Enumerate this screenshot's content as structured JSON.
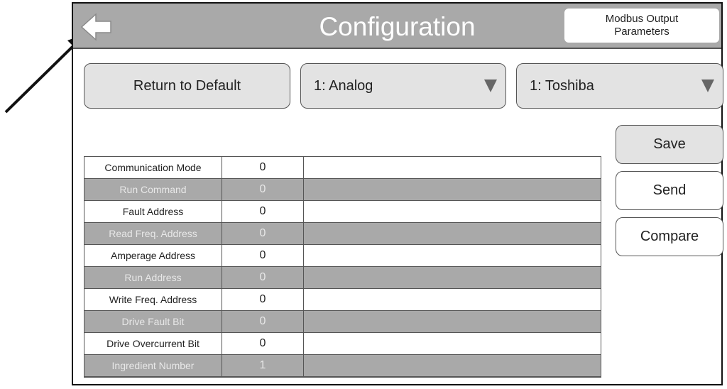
{
  "header": {
    "title": "Configuration",
    "page_label": "Modbus Output Parameters"
  },
  "controls": {
    "return_default_label": "Return to Default",
    "dropdown_mode_value": "1: Analog",
    "dropdown_drive_value": "1: Toshiba"
  },
  "side_buttons": {
    "save_label": "Save",
    "send_label": "Send",
    "compare_label": "Compare"
  },
  "parameters": [
    {
      "name": "Communication Mode",
      "value": "0",
      "note": ""
    },
    {
      "name": "Run Command",
      "value": "0",
      "note": ""
    },
    {
      "name": "Fault Address",
      "value": "0",
      "note": ""
    },
    {
      "name": "Read Freq. Address",
      "value": "0",
      "note": ""
    },
    {
      "name": "Amperage Address",
      "value": "0",
      "note": ""
    },
    {
      "name": "Run Address",
      "value": "0",
      "note": ""
    },
    {
      "name": "Write Freq. Address",
      "value": "0",
      "note": ""
    },
    {
      "name": "Drive Fault Bit",
      "value": "0",
      "note": ""
    },
    {
      "name": "Drive Overcurrent Bit",
      "value": "0",
      "note": ""
    },
    {
      "name": "Ingredient Number",
      "value": "1",
      "note": ""
    }
  ],
  "colors": {
    "header_gray": "#a9a9a9",
    "button_fill": "#e3e3e3",
    "border": "#555555"
  },
  "icons": {
    "back": "back-arrow-icon",
    "dropdown": "triangle-down-icon",
    "annotation": "annotation-arrow"
  }
}
